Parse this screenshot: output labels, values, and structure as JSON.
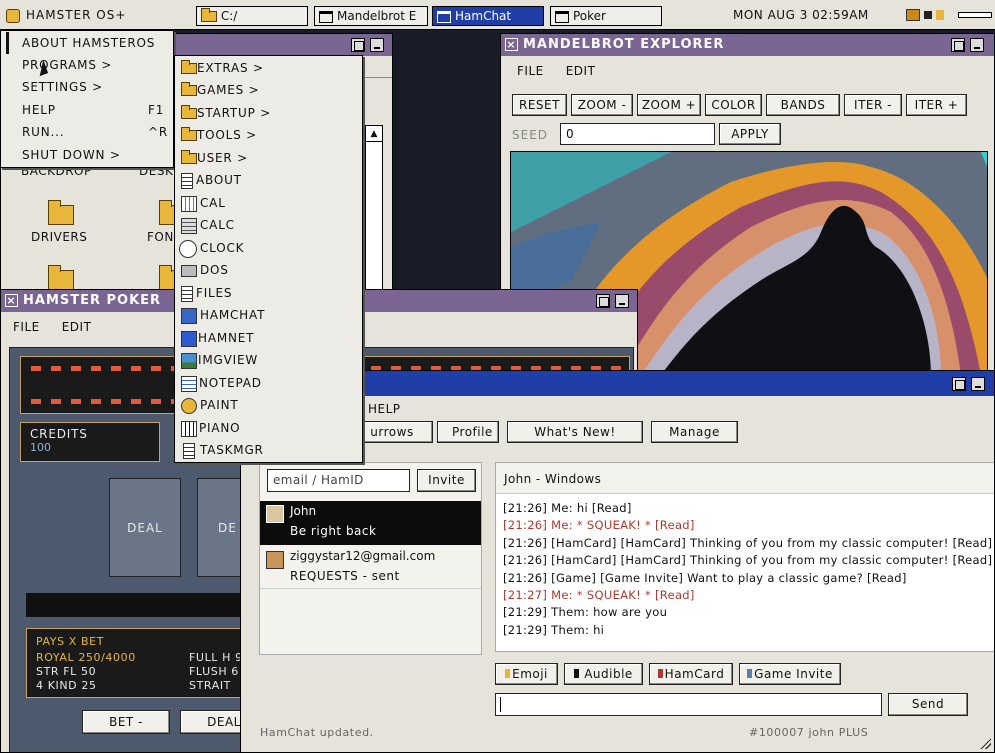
{
  "taskbar": {
    "start_label": "HAMSTER OS",
    "tasks": [
      "C:/",
      "Mandelbrot E",
      "HamChat",
      "Poker"
    ],
    "clock": "MON AUG 3 02:59AM"
  },
  "start_menu": {
    "items": [
      {
        "label": "ABOUT HAMSTEROS",
        "shortcut": ""
      },
      {
        "label": "PROGRAMS >",
        "shortcut": ""
      },
      {
        "label": "SETTINGS >",
        "shortcut": ""
      },
      {
        "label": "HELP",
        "shortcut": "F1"
      },
      {
        "label": "RUN...",
        "shortcut": "^R"
      },
      {
        "label": "SHUT DOWN >",
        "shortcut": ""
      }
    ]
  },
  "programs_menu": {
    "items": [
      "EXTRAS >",
      "GAMES >",
      "STARTUP >",
      "TOOLS >",
      "USER >",
      "ABOUT",
      "CAL",
      "CALC",
      "CLOCK",
      "DOS",
      "FILES",
      "HAMCHAT",
      "HAMNET",
      "IMGVIEW",
      "NOTEPAD",
      "PAINT",
      "PIANO",
      "TASKMGR"
    ]
  },
  "explorer": {
    "items": [
      "BACKDROP",
      "DESK",
      "DRIVERS",
      "FON"
    ]
  },
  "mandelbrot": {
    "title": "MANDELBROT EXPLORER",
    "menu": [
      "FILE",
      "EDIT"
    ],
    "buttons": [
      "RESET",
      "ZOOM -",
      "ZOOM +",
      "COLOR",
      "BANDS",
      "ITER -",
      "ITER +"
    ],
    "seed_label": "SEED",
    "seed_value": "0",
    "apply_label": "APPLY"
  },
  "poker": {
    "title": "HAMSTER POKER",
    "menu": [
      "FILE",
      "EDIT"
    ],
    "credits_label": "CREDITS",
    "credits_value": "100",
    "deal_cards": [
      "DEAL",
      "DE"
    ],
    "pays_header": "PAYS X BET",
    "pays_rows": [
      [
        "ROYAL 250/4000",
        "FULL H 9"
      ],
      [
        "STR FL 50",
        "FLUSH 6"
      ],
      [
        "4 KIND 25",
        "STRAIT"
      ]
    ],
    "bet_label": "BET -",
    "deal_label": "DEAL"
  },
  "hamchat": {
    "menu_help": "HELP",
    "tabs": [
      "urrows",
      "Profile",
      "What's New!",
      "Manage"
    ],
    "invite_placeholder": "email / HamID",
    "invite_label": "Invite",
    "contacts": [
      {
        "name": "John",
        "status": "Be right back"
      },
      {
        "name": "ziggystar12@gmail.com",
        "status": "REQUESTS - sent"
      }
    ],
    "chat_title": "John - Windows",
    "messages": [
      {
        "text": "[21:26] Me: hi [Read]",
        "color": "#111111"
      },
      {
        "text": "[21:26] Me: * SQUEAK! * [Read]",
        "color": "#b03a2e"
      },
      {
        "text": "[21:26] [HamCard] [HamCard] Thinking of you from my classic computer! [Read]",
        "color": "#111111"
      },
      {
        "text": "[21:26] [HamCard] [HamCard] Thinking of you from my classic computer! [Read]",
        "color": "#111111"
      },
      {
        "text": "[21:26] [Game] [Game Invite] Want to play a classic game? [Read]",
        "color": "#111111"
      },
      {
        "text": "[21:27] Me: * SQUEAK! * [Read]",
        "color": "#b03a2e"
      },
      {
        "text": "[21:29] Them: how are you",
        "color": "#111111"
      },
      {
        "text": "[21:29] Them: hi",
        "color": "#111111"
      }
    ],
    "attach_buttons": [
      {
        "label": "Emoji",
        "color": "#e8b63a"
      },
      {
        "label": "Audible",
        "color": "#111111"
      },
      {
        "label": "HamCard",
        "color": "#b03a2e"
      },
      {
        "label": "Game Invite",
        "color": "#5a7ea8"
      }
    ],
    "send_label": "Send",
    "status": "HamChat updated.",
    "user_id": "#100007 john PLUS"
  }
}
